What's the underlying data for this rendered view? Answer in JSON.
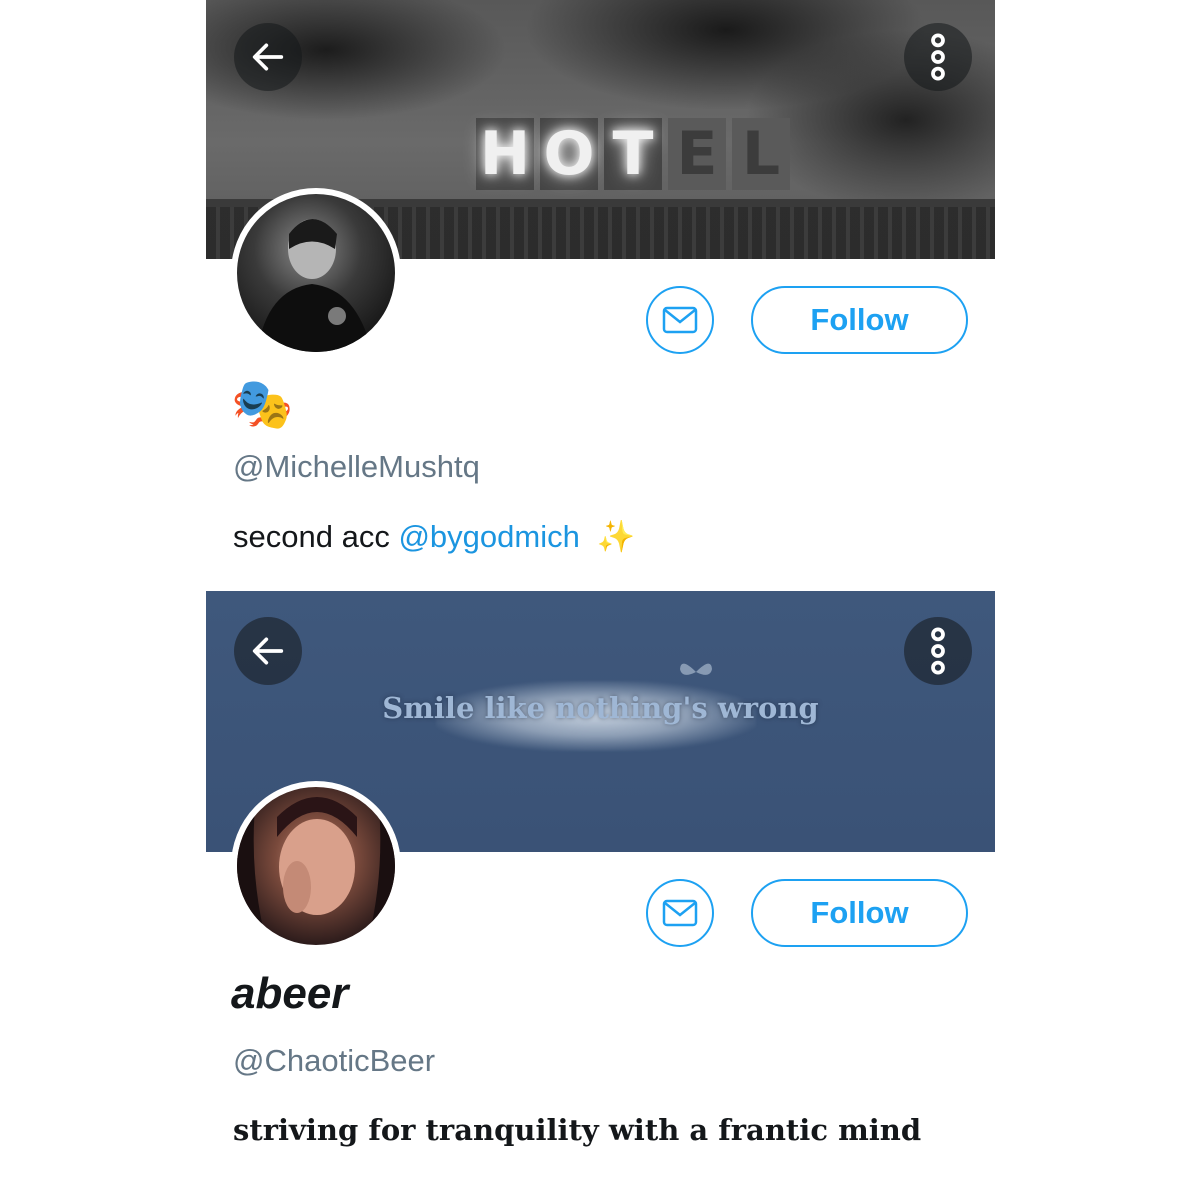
{
  "profiles": [
    {
      "banner_text": "HOTEL",
      "display_name": "🎭",
      "handle": "@MichelleMushtq",
      "bio": {
        "text": "second acc",
        "mention": "@bygodmich",
        "emoji": "✨"
      },
      "follow_label": "Follow"
    },
    {
      "banner_text": "Smile like nothing's wrong",
      "display_name": "abeer",
      "handle": "@ChaoticBeer",
      "bio": {
        "text": "striving for tranquility with a frantic mind"
      },
      "follow_label": "Follow"
    }
  ],
  "icons": {
    "back": "back-arrow-icon",
    "more": "more-vertical-icon",
    "message": "mail-icon"
  },
  "colors": {
    "accent": "#1da1f2",
    "mention": "#1b95e0",
    "secondary_text": "#657786",
    "primary_text": "#14171a"
  }
}
